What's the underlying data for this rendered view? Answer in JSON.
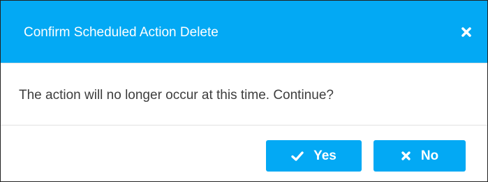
{
  "dialog": {
    "title": "Confirm Scheduled Action Delete",
    "message": "The action will no longer occur at this time. Continue?",
    "close_icon": "close-icon",
    "buttons": {
      "yes_label": "Yes",
      "yes_icon": "check-icon",
      "no_label": "No",
      "no_icon": "x-icon"
    }
  },
  "colors": {
    "header_bg": "#03a9f4",
    "button_bg": "#03a9f4",
    "text": "#3d3d3d"
  }
}
